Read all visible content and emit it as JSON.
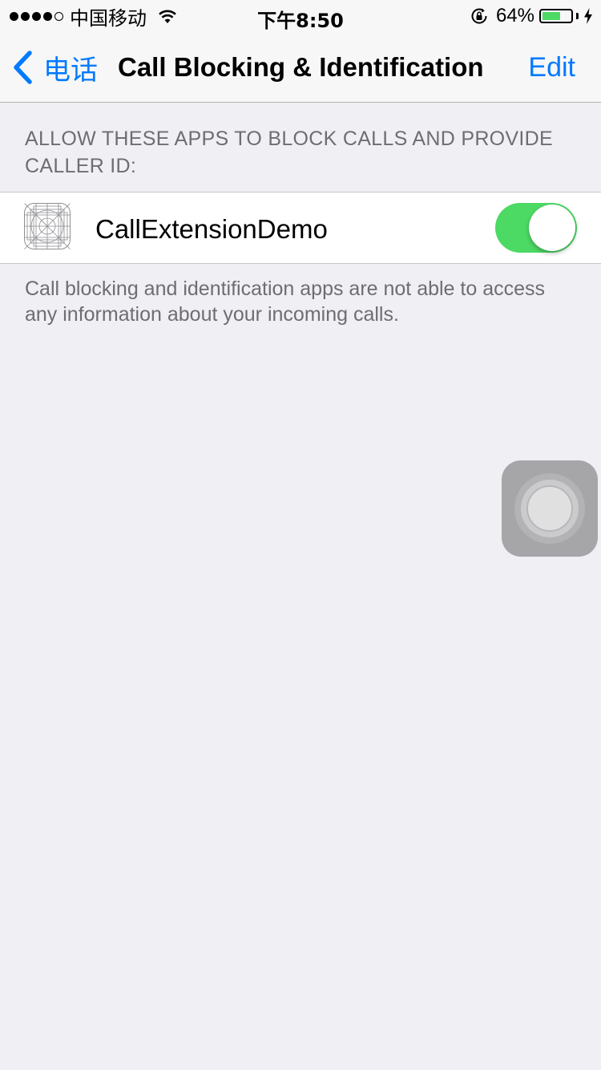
{
  "status_bar": {
    "signal_strength": 4,
    "signal_max": 5,
    "carrier": "中国移动",
    "wifi_icon": "wifi-icon",
    "time": "下午8:50",
    "rotation_lock_icon": "rotation-lock-icon",
    "battery_percent": "64%",
    "battery_level": 0.64,
    "charging_icon": "charging-bolt-icon"
  },
  "nav": {
    "back_label": "电话",
    "back_icon": "chevron-left-icon",
    "title": "Call Blocking & Identification",
    "edit_label": "Edit"
  },
  "section": {
    "header": "ALLOW THESE APPS TO BLOCK CALLS AND PROVIDE CALLER ID:",
    "items": [
      {
        "icon": "app-placeholder-icon",
        "name": "CallExtensionDemo",
        "enabled": true
      }
    ],
    "footer": "Call blocking and identification apps are not able to access any information about your incoming calls."
  },
  "colors": {
    "accent": "#007aff",
    "toggle_on": "#4cd964",
    "background": "#efeff4",
    "secondary_text": "#6d6d72"
  },
  "assistive_touch": {
    "icon": "assistive-touch-icon"
  }
}
